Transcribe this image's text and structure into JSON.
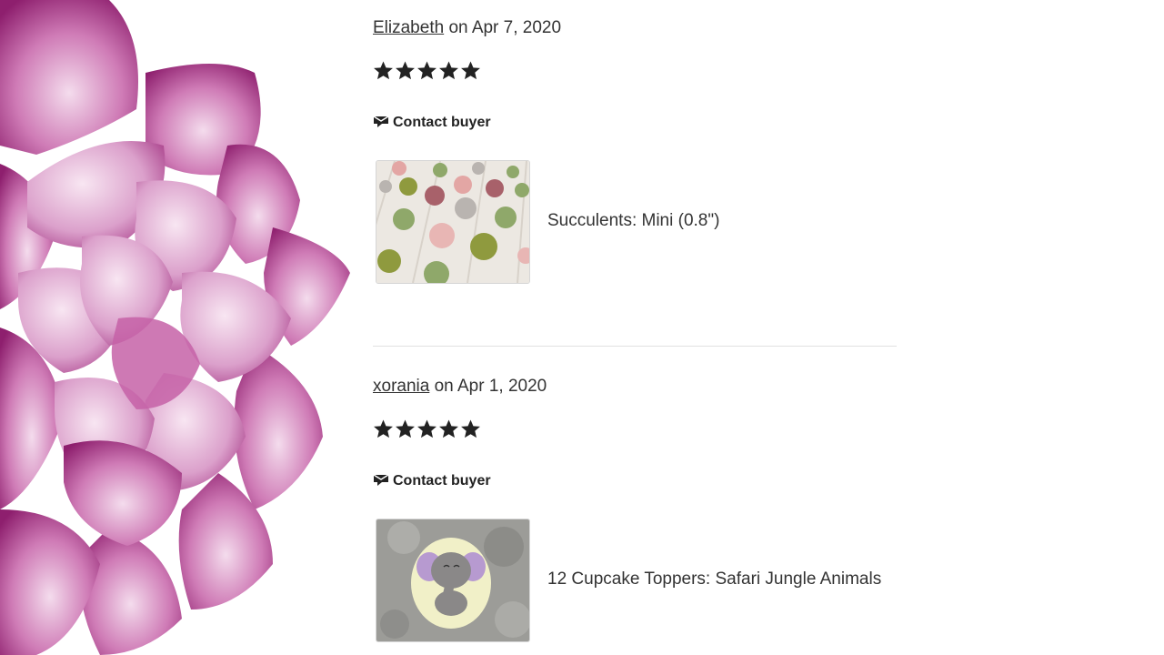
{
  "reviews": [
    {
      "reviewer": "Elizabeth",
      "date_text": " on Apr 7, 2020",
      "rating": 5,
      "contact_label": "Contact buyer",
      "item_title": "Succulents: Mini (0.8\")"
    },
    {
      "reviewer": "xorania",
      "date_text": " on Apr 1, 2020",
      "rating": 5,
      "contact_label": "Contact buyer",
      "item_title": "12 Cupcake Toppers: Safari Jungle Animals"
    }
  ],
  "colors": {
    "petal_dark": "#8e1f6e",
    "petal_mid": "#b8509a",
    "petal_light": "#e6bcd9",
    "text": "#222222",
    "divider": "#e1e1e1"
  },
  "icons": {
    "star": "star-icon",
    "contact": "message-icon"
  }
}
